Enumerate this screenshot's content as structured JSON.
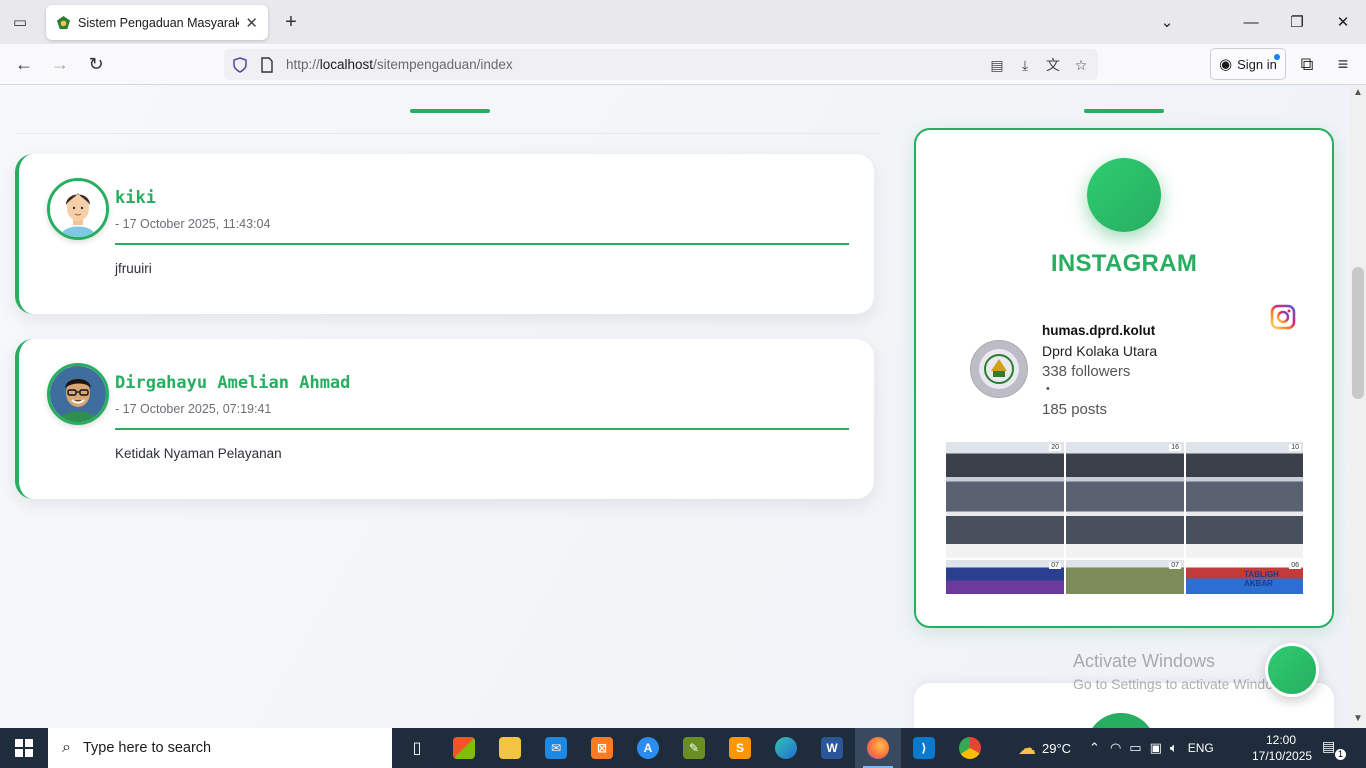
{
  "browser": {
    "tab_title": "Sistem Pengaduan Masyarakat | Dprd Kolaka Utara",
    "url_prefix": "http://",
    "url_host": "localhost",
    "url_path": "/sitempengaduan/index",
    "sign_in_label": "Sign in"
  },
  "complaints": [
    {
      "name": "kiki",
      "date": "- 17 October 2025, 11:43:04",
      "message": "jfruuiri"
    },
    {
      "name": "Dirgahayu Amelian Ahmad",
      "date": "- 17 October 2025, 07:19:41",
      "message": "Ketidak Nyaman Pelayanan"
    }
  ],
  "instagram": {
    "title": "INSTAGRAM",
    "handle": "humas.dprd.kolut",
    "display_name": "Dprd Kolaka Utara",
    "followers": "338 followers",
    "separator": "•",
    "posts": "185 posts",
    "thumb_numbers": [
      "20",
      "16",
      "10",
      "07",
      "07",
      "06"
    ],
    "tabligh_label": "TABLIGH AKBAR"
  },
  "activation": {
    "line1": "Activate Windows",
    "line2": "Go to Settings to activate Windows."
  },
  "taskbar": {
    "search_placeholder": "Type here to search",
    "temperature": "29°C",
    "language": "ENG",
    "time": "12:00",
    "date": "17/10/2025",
    "notification_count": "1"
  },
  "colors": {
    "accent": "#27ae60",
    "taskbar": "#1f2c3c"
  }
}
